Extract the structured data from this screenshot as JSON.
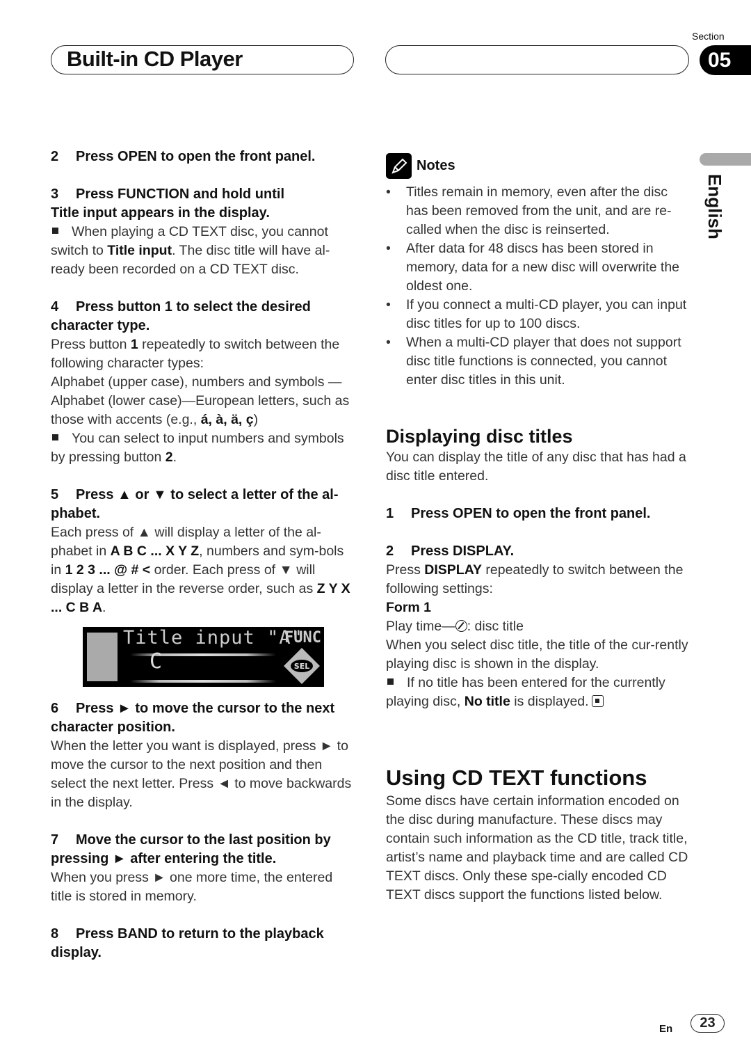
{
  "header": {
    "title": "Built-in CD Player",
    "section_label": "Section",
    "section_number": "05"
  },
  "sidebar": {
    "language": "English"
  },
  "left_column": {
    "step2": {
      "num": "2",
      "text": "Press OPEN to open the front panel."
    },
    "step3": {
      "num": "3",
      "line1": "Press FUNCTION and hold until",
      "line2": "Title input appears in the display.",
      "note_a": "When playing a CD TEXT disc, you cannot switch to ",
      "note_bold": "Title input",
      "note_b": ". The disc title will have al-ready been recorded on a CD TEXT disc."
    },
    "step4": {
      "num": "4",
      "heading": "Press button 1 to select the desired character type.",
      "body_a": "Press button ",
      "body_bold": "1",
      "body_b": " repeatedly to switch between the following character types:",
      "types_a": "Alphabet (upper case), numbers and symbols —Alphabet (lower case)—European letters, such as those with accents (e.g., ",
      "types_bold": "á, à, ä, ç",
      "types_b": ")",
      "note_a": "You can select to input numbers and symbols by pressing button ",
      "note_bold": "2",
      "note_b": "."
    },
    "step5": {
      "num": "5",
      "heading": "Press ▲ or ▼ to select a letter of the al-phabet.",
      "body_a": "Each press of ▲ will display a letter of the al-phabet in ",
      "bold1": "A B C ... X Y Z",
      "body_b": ", numbers and sym-bols in ",
      "bold2": "1 2 3 ... @ # <",
      "body_c": " order. Each press of ▼ will display a letter in the reverse order, such as ",
      "bold3": "Z Y X ... C B A",
      "body_d": "."
    },
    "lcd": {
      "title": "Title input \"A\"",
      "func": "FUNC",
      "char": "C",
      "sel": "SEL"
    },
    "step6": {
      "num": "6",
      "heading": "Press ► to move the cursor to the next character position.",
      "body": "When the letter you want is displayed, press ► to move the cursor to the next position and then select the next letter. Press ◄ to move backwards in the display."
    },
    "step7": {
      "num": "7",
      "heading": "Move the cursor to the last position by pressing ► after entering the title.",
      "body": "When you press ► one more time, the entered title is stored in memory."
    },
    "step8": {
      "num": "8",
      "heading": "Press BAND to return to the playback display."
    }
  },
  "right_column": {
    "notes": {
      "title": "Notes",
      "items": [
        "Titles remain in memory, even after the disc has been removed from the unit, and are re-called when the disc is reinserted.",
        "After data for 48 discs has been stored in memory, data for a new disc will overwrite the oldest one.",
        "If you connect a multi-CD player, you can input disc titles for up to 100 discs.",
        "When a multi-CD player that does not support disc title functions is connected, you cannot enter disc titles in this unit."
      ]
    },
    "displaying": {
      "heading": "Displaying disc titles",
      "intro": "You can display the title of any disc that has had a disc title entered.",
      "step1": {
        "num": "1",
        "text": "Press OPEN to open the front panel."
      },
      "step2": {
        "num": "2",
        "text": "Press DISPLAY."
      },
      "body_a": "Press ",
      "body_bold": "DISPLAY",
      "body_b": " repeatedly to switch between the following settings:",
      "form_label": "Form 1",
      "form_a": "Play time—",
      "form_b": ": disc title",
      "explain": "When you select disc title, the title of the cur-rently playing disc is shown in the display.",
      "note_a": "If no title has been entered for the currently playing disc, ",
      "note_bold": "No title",
      "note_b": " is displayed."
    },
    "cdtext": {
      "heading": "Using CD TEXT functions",
      "body": "Some discs have certain information encoded on the disc during manufacture. These discs may contain such information as the CD title, track title, artist’s name and playback time and are called CD TEXT discs. Only these spe-cially encoded CD TEXT discs support the functions listed below."
    }
  },
  "footer": {
    "lang_code": "En",
    "page_number": "23"
  }
}
